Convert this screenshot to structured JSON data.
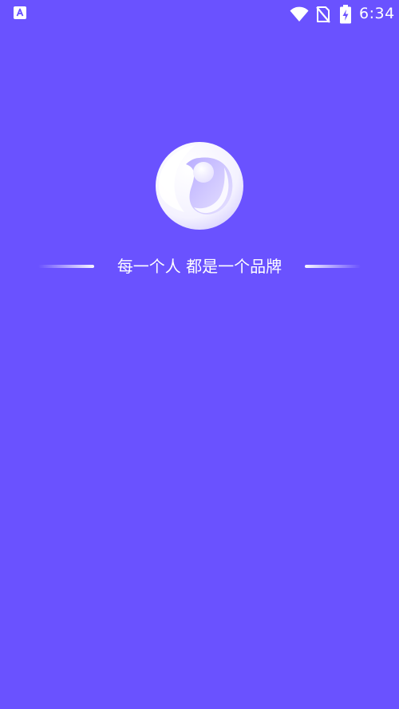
{
  "status_bar": {
    "time": "6:34",
    "left_icon": "app-notification-icon",
    "icons": [
      "wifi-icon",
      "no-sim-icon",
      "battery-charging-icon"
    ]
  },
  "splash": {
    "logo_icon": "brand-logo-icon",
    "slogan": "每一个人 都是一个品牌"
  },
  "colors": {
    "background": "#6A52FF",
    "text": "#FFFFFF"
  }
}
